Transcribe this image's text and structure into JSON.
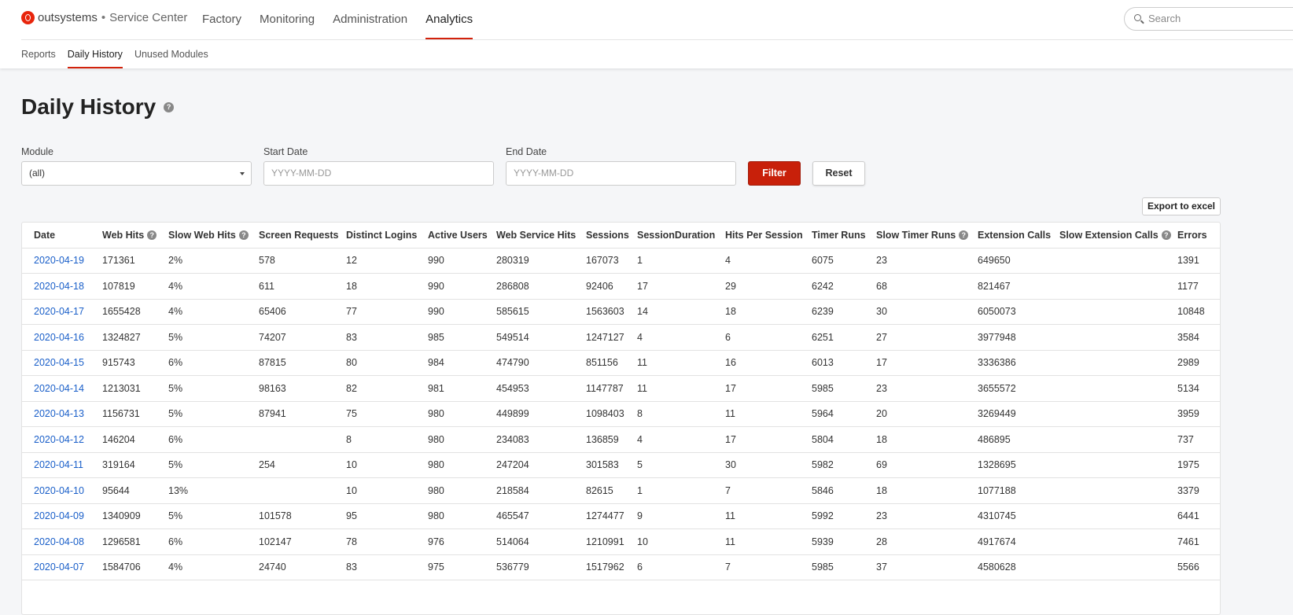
{
  "app": {
    "brand": "outsystems",
    "separator": "•",
    "product": "Service Center"
  },
  "nav": [
    {
      "label": "Factory"
    },
    {
      "label": "Monitoring"
    },
    {
      "label": "Administration"
    },
    {
      "label": "Analytics",
      "active": true
    }
  ],
  "search": {
    "placeholder": "Search"
  },
  "subnav": [
    {
      "label": "Reports"
    },
    {
      "label": "Daily History",
      "active": true
    },
    {
      "label": "Unused Modules"
    }
  ],
  "page": {
    "title": "Daily History",
    "help_icon": "question-circle-icon"
  },
  "filters": {
    "module_label": "Module",
    "module_value": "(all)",
    "start_label": "Start Date",
    "start_placeholder": "YYYY-MM-DD",
    "end_label": "End Date",
    "end_placeholder": "YYYY-MM-DD",
    "filter_button": "Filter",
    "reset_button": "Reset"
  },
  "export_button": "Export to excel",
  "colors": {
    "accent": "#c8200a",
    "link": "#1a5fc9"
  },
  "table": {
    "columns": [
      {
        "label": "Date"
      },
      {
        "label": "Web Hits",
        "help": true
      },
      {
        "label": "Slow Web Hits",
        "help": true
      },
      {
        "label": "Screen Requests"
      },
      {
        "label": "Distinct  Logins"
      },
      {
        "label": "Active Users"
      },
      {
        "label": "Web Service Hits"
      },
      {
        "label": "Sessions"
      },
      {
        "label": "SessionDuration"
      },
      {
        "label": "Hits Per Session"
      },
      {
        "label": "Timer Runs"
      },
      {
        "label": "Slow Timer Runs",
        "help": true
      },
      {
        "label": "Extension Calls"
      },
      {
        "label": "Slow Extension Calls",
        "help": true
      },
      {
        "label": "Errors"
      }
    ],
    "rows": [
      [
        "2020-04-19",
        "171361",
        "2%",
        "578",
        "12",
        "990",
        "280319",
        "167073",
        "1",
        "4",
        "6075",
        "23",
        "649650",
        "",
        "1391"
      ],
      [
        "2020-04-18",
        "107819",
        "4%",
        "611",
        "18",
        "990",
        "286808",
        "92406",
        "17",
        "29",
        "6242",
        "68",
        "821467",
        "",
        "1177"
      ],
      [
        "2020-04-17",
        "1655428",
        "4%",
        "65406",
        "77",
        "990",
        "585615",
        "1563603",
        "14",
        "18",
        "6239",
        "30",
        "6050073",
        "",
        "10848"
      ],
      [
        "2020-04-16",
        "1324827",
        "5%",
        "74207",
        "83",
        "985",
        "549514",
        "1247127",
        "4",
        "6",
        "6251",
        "27",
        "3977948",
        "",
        "3584"
      ],
      [
        "2020-04-15",
        "915743",
        "6%",
        "87815",
        "80",
        "984",
        "474790",
        "851156",
        "11",
        "16",
        "6013",
        "17",
        "3336386",
        "",
        "2989"
      ],
      [
        "2020-04-14",
        "1213031",
        "5%",
        "98163",
        "82",
        "981",
        "454953",
        "1147787",
        "11",
        "17",
        "5985",
        "23",
        "3655572",
        "",
        "5134"
      ],
      [
        "2020-04-13",
        "1156731",
        "5%",
        "87941",
        "75",
        "980",
        "449899",
        "1098403",
        "8",
        "11",
        "5964",
        "20",
        "3269449",
        "",
        "3959"
      ],
      [
        "2020-04-12",
        "146204",
        "6%",
        "",
        "8",
        "980",
        "234083",
        "136859",
        "4",
        "17",
        "5804",
        "18",
        "486895",
        "",
        "737"
      ],
      [
        "2020-04-11",
        "319164",
        "5%",
        "254",
        "10",
        "980",
        "247204",
        "301583",
        "5",
        "30",
        "5982",
        "69",
        "1328695",
        "",
        "1975"
      ],
      [
        "2020-04-10",
        "95644",
        "13%",
        "",
        "10",
        "980",
        "218584",
        "82615",
        "1",
        "7",
        "5846",
        "18",
        "1077188",
        "",
        "3379"
      ],
      [
        "2020-04-09",
        "1340909",
        "5%",
        "101578",
        "95",
        "980",
        "465547",
        "1274477",
        "9",
        "11",
        "5992",
        "23",
        "4310745",
        "",
        "6441"
      ],
      [
        "2020-04-08",
        "1296581",
        "6%",
        "102147",
        "78",
        "976",
        "514064",
        "1210991",
        "10",
        "11",
        "5939",
        "28",
        "4917674",
        "",
        "7461"
      ],
      [
        "2020-04-07",
        "1584706",
        "4%",
        "24740",
        "83",
        "975",
        "536779",
        "1517962",
        "6",
        "7",
        "5985",
        "37",
        "4580628",
        "",
        "5566"
      ]
    ]
  }
}
